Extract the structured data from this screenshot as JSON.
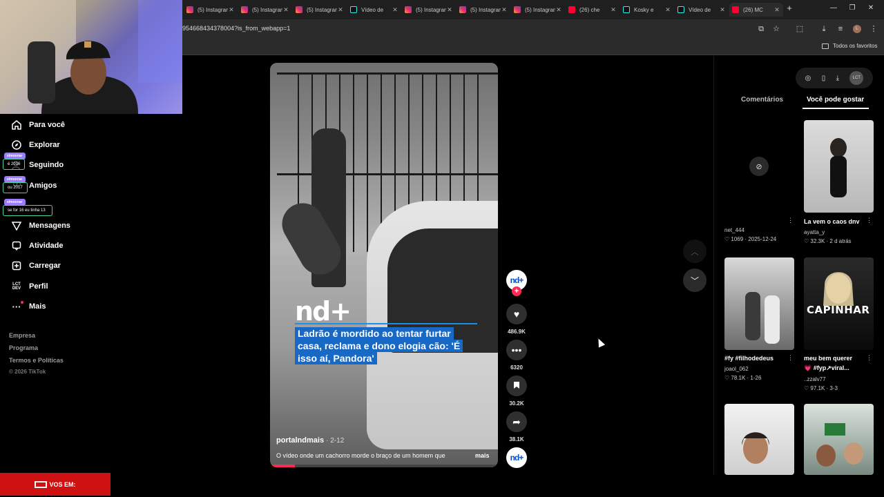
{
  "browser": {
    "tabs": [
      {
        "title": "(5) Instagram",
        "icon": "instagram-icon"
      },
      {
        "title": "(5) Instagram",
        "icon": "instagram-icon"
      },
      {
        "title": "(5) Instagram",
        "icon": "instagram-icon"
      },
      {
        "title": "Vídeo de",
        "icon": "tiktok-icon"
      },
      {
        "title": "(5) Instagram",
        "icon": "instagram-icon"
      },
      {
        "title": "(5) Instagram",
        "icon": "instagram-icon"
      },
      {
        "title": "(5) Instagram",
        "icon": "instagram-icon"
      },
      {
        "title": "(26) che",
        "icon": "youtube-icon"
      },
      {
        "title": "Kosky e",
        "icon": "tiktok-icon"
      },
      {
        "title": "Vídeo de",
        "icon": "tiktok-icon"
      },
      {
        "title": "(26) MC",
        "icon": "youtube-icon"
      }
    ],
    "new_tab": "+",
    "url": "954668434378004?is_from_webapp=1",
    "bookmarks_all": "Todos os favoritos"
  },
  "sidebar": {
    "items": [
      {
        "label": "Para você",
        "icon": "home-icon"
      },
      {
        "label": "Explorar",
        "icon": "compass-icon"
      },
      {
        "label": "Seguindo",
        "icon": "following-icon"
      },
      {
        "label": "Amigos",
        "icon": "friends-icon"
      },
      {
        "label": "Mensagens",
        "icon": "messages-icon"
      },
      {
        "label": "Atividade",
        "icon": "activity-icon"
      },
      {
        "label": "Carregar",
        "icon": "upload-icon"
      },
      {
        "label": "Perfil",
        "icon": "profile-icon"
      },
      {
        "label": "Mais",
        "icon": "more-icon"
      }
    ],
    "footer": [
      "Empresa",
      "Programa",
      "Termos e Políticas",
      "© 2026 TikTok"
    ]
  },
  "overlay": {
    "chat": [
      {
        "badge": "elmoonar",
        "message": "é 2016"
      },
      {
        "badge": "elmoonar",
        "message": "ou 2017"
      },
      {
        "badge": "elmoonar",
        "message": "se for 16 eu tinha 13"
      }
    ],
    "live_banner": "VOS EM:"
  },
  "video": {
    "brand": "nd+",
    "headline": "Ladrão é mordido ao tentar furtar casa, reclama e dono elogia cão: 'É isso aí, Pandora'",
    "author": "portalndmais",
    "date": "· 2-12",
    "description": "O vídeo onde um cachorro morde o braço de um homem que",
    "more": "mais",
    "progress_fraction": 0.11
  },
  "actions": {
    "likes": "486.9K",
    "comments": "6320",
    "saves": "30.2K",
    "shares": "38.1K"
  },
  "right_panel": {
    "tools_user": "LCT",
    "tabs": [
      "Comentários",
      "Você pode gostar"
    ],
    "cards": [
      {
        "title": "",
        "user": "net_444",
        "meta": "♡ 1069 · 2025-12-24"
      },
      {
        "title": "La vem o caos dnv",
        "user": "ayatta_y",
        "meta": "♡ 32.3K · 2 d atrás"
      },
      {
        "title": "#fy #filhodedeus",
        "user": "joaol_062",
        "meta": "♡ 78.1K · 1-26"
      },
      {
        "title": "meu bem querer",
        "subtitle": "💗 #fyp↗viral...",
        "user": "..zzalv77",
        "meta": "♡ 97.1K · 3-3",
        "overlay": "CAPINHAR"
      }
    ]
  },
  "colors": {
    "accent": "#fe2c55",
    "headline_bg": "#1769c5",
    "live": "#d01111"
  }
}
